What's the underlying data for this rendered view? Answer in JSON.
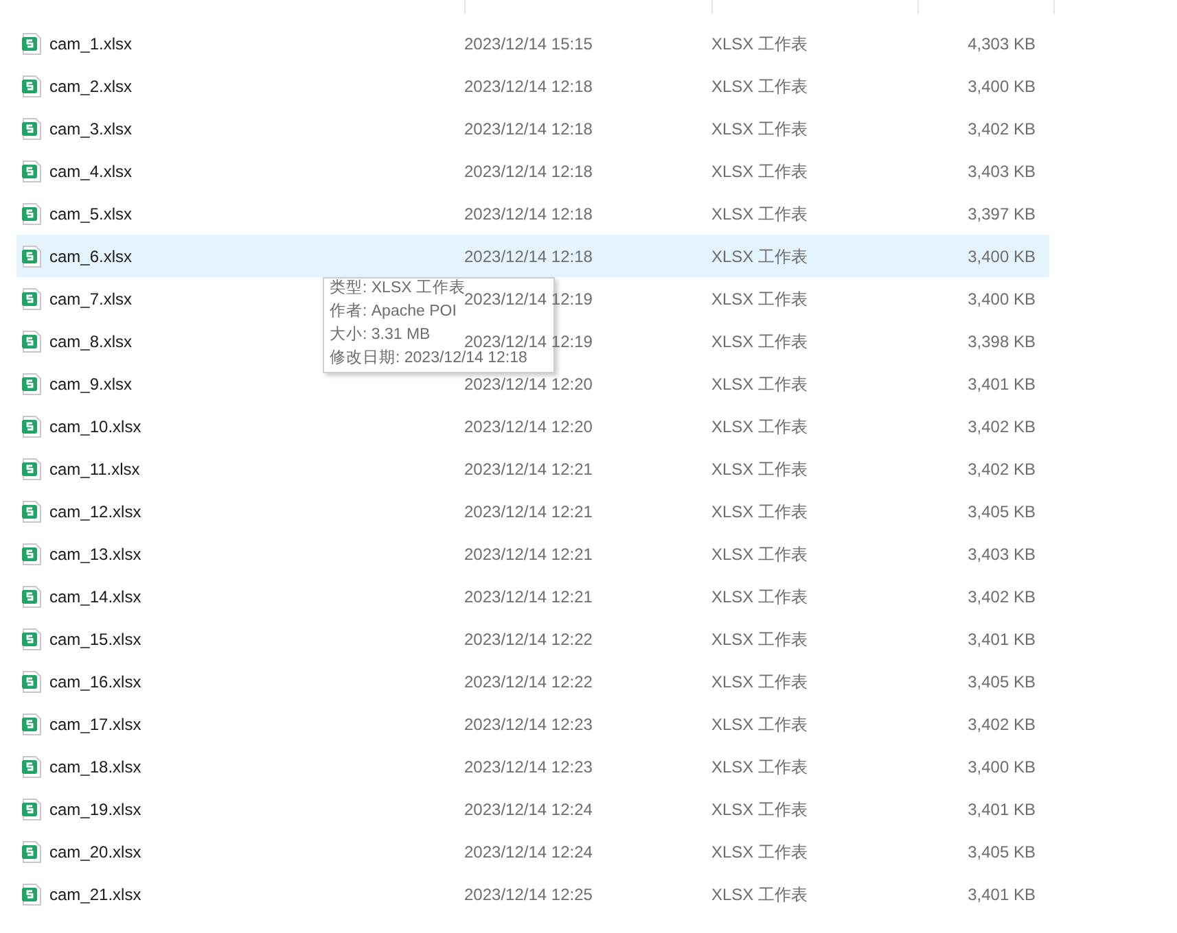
{
  "files": [
    {
      "name": "cam_1.xlsx",
      "modified": "2023/12/14 15:15",
      "type": "XLSX 工作表",
      "size": "4,303 KB",
      "selected": false
    },
    {
      "name": "cam_2.xlsx",
      "modified": "2023/12/14 12:18",
      "type": "XLSX 工作表",
      "size": "3,400 KB",
      "selected": false
    },
    {
      "name": "cam_3.xlsx",
      "modified": "2023/12/14 12:18",
      "type": "XLSX 工作表",
      "size": "3,402 KB",
      "selected": false
    },
    {
      "name": "cam_4.xlsx",
      "modified": "2023/12/14 12:18",
      "type": "XLSX 工作表",
      "size": "3,403 KB",
      "selected": false
    },
    {
      "name": "cam_5.xlsx",
      "modified": "2023/12/14 12:18",
      "type": "XLSX 工作表",
      "size": "3,397 KB",
      "selected": false
    },
    {
      "name": "cam_6.xlsx",
      "modified": "2023/12/14 12:18",
      "type": "XLSX 工作表",
      "size": "3,400 KB",
      "selected": true
    },
    {
      "name": "cam_7.xlsx",
      "modified": "2023/12/14 12:19",
      "type": "XLSX 工作表",
      "size": "3,400 KB",
      "selected": false
    },
    {
      "name": "cam_8.xlsx",
      "modified": "2023/12/14 12:19",
      "type": "XLSX 工作表",
      "size": "3,398 KB",
      "selected": false
    },
    {
      "name": "cam_9.xlsx",
      "modified": "2023/12/14 12:20",
      "type": "XLSX 工作表",
      "size": "3,401 KB",
      "selected": false
    },
    {
      "name": "cam_10.xlsx",
      "modified": "2023/12/14 12:20",
      "type": "XLSX 工作表",
      "size": "3,402 KB",
      "selected": false
    },
    {
      "name": "cam_11.xlsx",
      "modified": "2023/12/14 12:21",
      "type": "XLSX 工作表",
      "size": "3,402 KB",
      "selected": false
    },
    {
      "name": "cam_12.xlsx",
      "modified": "2023/12/14 12:21",
      "type": "XLSX 工作表",
      "size": "3,405 KB",
      "selected": false
    },
    {
      "name": "cam_13.xlsx",
      "modified": "2023/12/14 12:21",
      "type": "XLSX 工作表",
      "size": "3,403 KB",
      "selected": false
    },
    {
      "name": "cam_14.xlsx",
      "modified": "2023/12/14 12:21",
      "type": "XLSX 工作表",
      "size": "3,402 KB",
      "selected": false
    },
    {
      "name": "cam_15.xlsx",
      "modified": "2023/12/14 12:22",
      "type": "XLSX 工作表",
      "size": "3,401 KB",
      "selected": false
    },
    {
      "name": "cam_16.xlsx",
      "modified": "2023/12/14 12:22",
      "type": "XLSX 工作表",
      "size": "3,405 KB",
      "selected": false
    },
    {
      "name": "cam_17.xlsx",
      "modified": "2023/12/14 12:23",
      "type": "XLSX 工作表",
      "size": "3,402 KB",
      "selected": false
    },
    {
      "name": "cam_18.xlsx",
      "modified": "2023/12/14 12:23",
      "type": "XLSX 工作表",
      "size": "3,400 KB",
      "selected": false
    },
    {
      "name": "cam_19.xlsx",
      "modified": "2023/12/14 12:24",
      "type": "XLSX 工作表",
      "size": "3,401 KB",
      "selected": false
    },
    {
      "name": "cam_20.xlsx",
      "modified": "2023/12/14 12:24",
      "type": "XLSX 工作表",
      "size": "3,405 KB",
      "selected": false
    },
    {
      "name": "cam_21.xlsx",
      "modified": "2023/12/14 12:25",
      "type": "XLSX 工作表",
      "size": "3,401 KB",
      "selected": false
    }
  ],
  "tooltip": {
    "lines": [
      "类型: XLSX 工作表",
      "作者: Apache POI",
      "大小: 3.31 MB",
      "修改日期: 2023/12/14 12:18"
    ]
  }
}
